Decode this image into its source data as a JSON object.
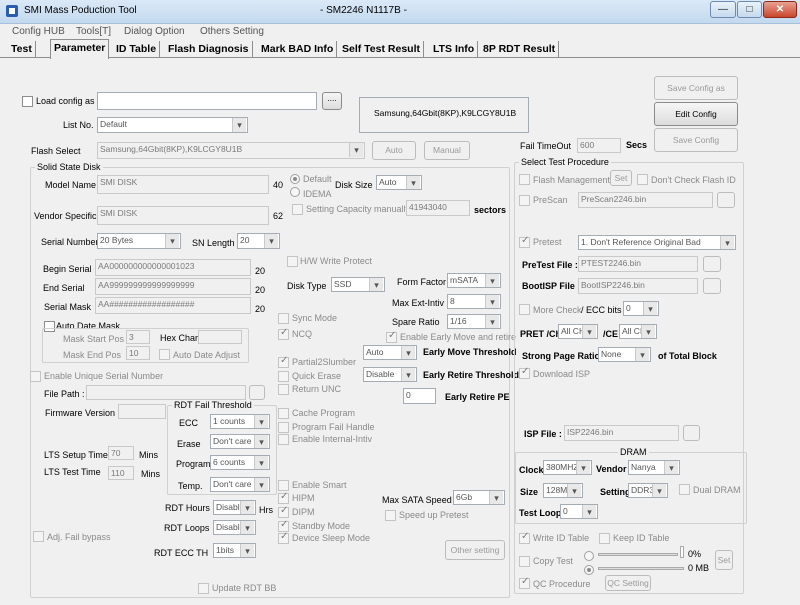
{
  "window": {
    "app_title": "SMI Mass Poduction Tool",
    "device_title": "- SM2246 N1117B -",
    "min": "—",
    "max": "□",
    "close": "✕"
  },
  "menu": [
    "Config HUB",
    "Tools[T]",
    "Dialog Option",
    "Others Setting"
  ],
  "tabs": [
    "Test",
    "Parameter",
    "ID Table",
    "Flash Diagnosis",
    "Mark BAD Info",
    "Self Test Result",
    "LTS Info",
    "8P RDT Result"
  ],
  "config": {
    "load_label": "Load config as",
    "load_value": "",
    "browse": "....",
    "list_no_label": "List No.",
    "list_no": "Default",
    "flash_info": "Samsung,64Gbit(8KP),K9LCGY8U1B",
    "save_as": "Save Config as",
    "edit": "Edit Config",
    "save": "Save Config",
    "flash_select_label": "Flash Select",
    "flash_select": "Samsung,64Gbit(8KP),K9LCGY8U1B",
    "auto": "Auto",
    "manual": "Manual",
    "fail_timeout_label": "Fail TimeOut",
    "fail_timeout": "600",
    "secs": "Secs"
  },
  "ssd": {
    "group": "Solid State Disk",
    "model_label": "Model Name",
    "model": "SMI DISK",
    "model_len": "40",
    "default": "Default",
    "idema": "IDEMA",
    "disk_size_label": "Disk Size",
    "disk_size": "Auto",
    "cap_manual": "Setting Capacity manually",
    "cap_value": "41943040",
    "sectors": "sectors",
    "vendor_label": "Vendor Specific",
    "vendor": "SMI DISK",
    "vendor_len": "62",
    "serial_num_label": "Serial Number",
    "serial_num": "20 Bytes",
    "sn_length_label": "SN Length",
    "sn_length": "20",
    "hw_wp": "H/W Write Protect",
    "begin_label": "Begin Serial",
    "begin": "AA000000000000001023",
    "begin_len": "20",
    "end_label": "End Serial",
    "end": "AA999999999999999999",
    "end_len": "20",
    "mask_label": "Serial Mask",
    "mask": "AA##################",
    "mask_len": "20",
    "disk_type_label": "Disk Type",
    "disk_type": "SSD",
    "form_factor_label": "Form Factor",
    "form_factor": "mSATA",
    "max_ext_label": "Max Ext-Intiv",
    "max_ext": "8",
    "spare_label": "Spare Ratio",
    "spare": "1/16",
    "auto_date": "Auto Date Mask",
    "mask_start_label": "Mask Start Pos",
    "mask_start": "3",
    "hex_char_label": "Hex Char:",
    "hex_char": "",
    "mask_end_label": "Mask End Pos",
    "mask_end": "10",
    "auto_date_adjust": "Auto Date Adjust",
    "sync_mode": "Sync Mode",
    "ncq": "NCQ",
    "early_move_retire": "Enable Early Move and retire",
    "partial": "Partial2Slumber",
    "early_move_sel": "Auto",
    "early_move_label": "Early Move Threshold",
    "quick_erase": "Quick Erase",
    "early_retire_sel": "Disable",
    "early_retire_label": "Early Retire Threshold",
    "return_unc": "Return UNC",
    "early_pe_value": "0",
    "early_pe_label": "Early Retire PE",
    "unique_serial": "Enable Unique Serial Number",
    "file_path_label": "File Path :",
    "file_path": "",
    "fw_label": "Firmware Version",
    "fw": "",
    "cache_program": "Cache Program",
    "program_fail": "Program Fail Handle",
    "internal_intiv": "Enable Internal-Intiv",
    "lts_setup_label": "LTS Setup Time",
    "lts_setup": "70",
    "mins": "Mins",
    "lts_test_label": "LTS Test Time",
    "lts_test": "110",
    "mins2": "Mins",
    "enable_smart": "Enable Smart",
    "hipm": "HIPM",
    "dipm": "DIPM",
    "standby": "Standby Mode",
    "device_sleep": "Device Sleep Mode",
    "max_sata_label": "Max SATA Speed",
    "max_sata": "6Gb",
    "speed_pretest": "Speed up Pretest",
    "adj_fail": "Adj. Fail bypass",
    "other_setting": "Other setting"
  },
  "rdt": {
    "group": "RDT Fail Threshold",
    "ecc_label": "ECC",
    "ecc": "1 counts",
    "erase_label": "Erase",
    "erase": "Don't care",
    "program_label": "Program",
    "program": "6 counts",
    "temp_label": "Temp.",
    "temp": "Don't care",
    "hours_label": "RDT Hours",
    "hours": "Disable",
    "hrs": "Hrs",
    "loops_label": "RDT Loops",
    "loops": "Disable",
    "ecc_th_label": "RDT ECC TH",
    "ecc_th": "1bits",
    "update_bb": "Update RDT BB"
  },
  "procedure": {
    "group": "Select Test Procedure",
    "flash_mgmt": "Flash Management",
    "set": "Set",
    "dont_check": "Don't Check Flash ID",
    "prescan": "PreScan",
    "prescan_file": "PreScan2246.bin",
    "pretest": "Pretest",
    "pretest_mode": "1. Don't Reference Original Bad",
    "pretest_file_label": "PreTest File :",
    "pretest_file": "PTEST2246.bin",
    "bootisp_label": "BootISP File :",
    "bootisp": "BootISP2246.bin",
    "more_check": "More Check",
    "ecc_bits_label": "/ ECC bits",
    "ecc_bits": "0",
    "pret_ch_label": "PRET /Ch",
    "pret_ch": "All CH",
    "ce_label": "/CE",
    "ce": "All CE",
    "strong_label": "Strong Page Ratio :",
    "strong": "None",
    "of_total": "of Total Block",
    "download_isp": "Download ISP",
    "isp_label": "ISP File :",
    "isp": "ISP2246.bin"
  },
  "dram": {
    "group": "DRAM",
    "clock_label": "Clock",
    "clock": "380MHZ",
    "vendor_label": "Vendor",
    "vendor": "Nanya",
    "size_label": "Size",
    "size": "128M",
    "setting_label": "Setting",
    "setting": "DDR3",
    "dual": "Dual DRAM",
    "loop_label": "Test Loop",
    "loop": "0"
  },
  "bottom": {
    "write_id": "Write ID Table",
    "keep_id": "Keep ID Table",
    "copy_test": "Copy Test",
    "pct": "0%",
    "mb": "0 MB",
    "set": "Set",
    "qc": "QC Procedure",
    "qc_setting": "QC Setting"
  }
}
